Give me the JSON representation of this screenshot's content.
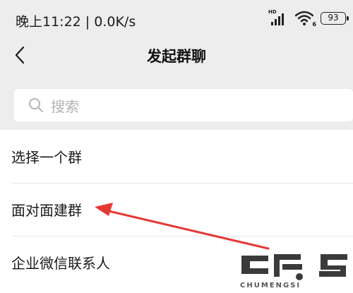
{
  "status_bar": {
    "time_speed": "晚上11:22 | 0.0K/s",
    "network_badge": "HD",
    "wifi_badge": "6",
    "battery_level": "93",
    "icons": [
      "signal-icon",
      "wifi-icon",
      "battery-icon"
    ]
  },
  "nav": {
    "title": "发起群聊",
    "back_icon": "chevron-left-icon"
  },
  "search": {
    "placeholder": "搜索",
    "icon": "search-icon"
  },
  "list": {
    "items": [
      {
        "label": "选择一个群"
      },
      {
        "label": "面对面建群"
      },
      {
        "label": "企业微信联系人"
      }
    ]
  },
  "annotation": {
    "arrow_color": "#e53935"
  },
  "watermark": {
    "text": "CHUMENGSI"
  }
}
